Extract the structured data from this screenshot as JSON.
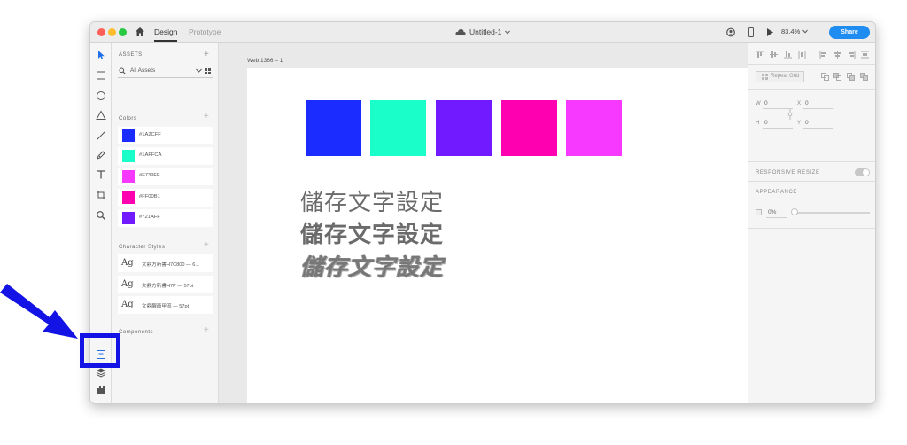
{
  "titlebar": {
    "tabs": {
      "design": "Design",
      "prototype": "Prototype"
    },
    "document_title": "Untitled-1",
    "zoom": "83.4%",
    "share_label": "Share"
  },
  "assets": {
    "header": "ASSETS",
    "filter_value": "All Assets",
    "colors_header": "Colors",
    "colors": [
      {
        "label": "#1A2CFF",
        "hex": "#1A2CFF"
      },
      {
        "label": "#1AFFCA",
        "hex": "#1AFFCA"
      },
      {
        "label": "#F739FF",
        "hex": "#F739FF"
      },
      {
        "label": "#FF00B1",
        "hex": "#FF00B1"
      },
      {
        "label": "#721AFF",
        "hex": "#721AFF"
      }
    ],
    "character_styles_header": "Character Styles",
    "character_styles": [
      {
        "glyph": "Ag",
        "label": "文鼎方新書H7C800 — 6..."
      },
      {
        "glyph": "Ag",
        "label": "文鼎方新書H7P — 57pt"
      },
      {
        "glyph": "Ag",
        "label": "文鼎醒爺甲流 — 57pt"
      }
    ],
    "components_header": "Components"
  },
  "canvas": {
    "artboard_label": "Web 1366 – 1",
    "swatches": [
      {
        "hex": "#1A2CFF"
      },
      {
        "hex": "#1AFFCA"
      },
      {
        "hex": "#721AFF"
      },
      {
        "hex": "#FF00B1"
      },
      {
        "hex": "#F739FF"
      }
    ],
    "texts": [
      "儲存文字設定",
      "儲存文字設定",
      "儲存文字設定"
    ]
  },
  "properties": {
    "repeat_grid": "Repeat Grid",
    "w_label": "W",
    "w_value": "0",
    "x_label": "X",
    "x_value": "0",
    "h_label": "H",
    "h_value": "0",
    "y_label": "Y",
    "y_value": "0",
    "responsive_resize": "RESPONSIVE RESIZE",
    "appearance": "APPEARANCE",
    "opacity": "0%"
  },
  "annotation": {
    "color": "#1313E6"
  }
}
